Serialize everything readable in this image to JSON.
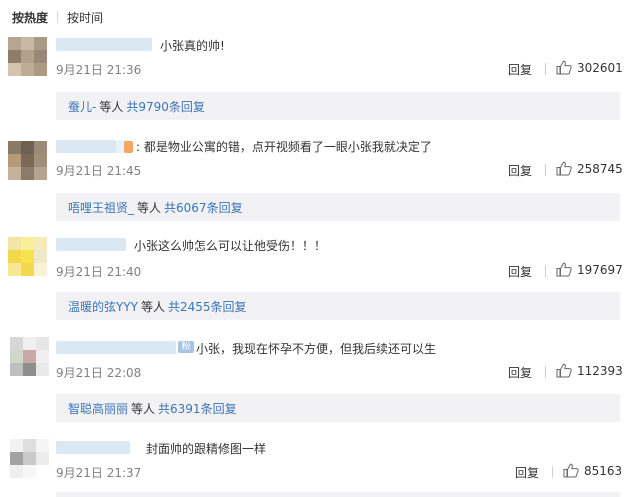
{
  "sort": {
    "hot_label": "按热度",
    "time_label": "按时间"
  },
  "comments": [
    {
      "text": "小张真的帅!",
      "time": "9月21日 21:36",
      "reply_label": "回复",
      "likes": "302601",
      "sub": {
        "name": "蚕儿-",
        "mid": "等人",
        "link": "共9790条回复"
      }
    },
    {
      "text": ": 都是物业公寓的错，点开视频看了一眼小张我就决定了",
      "time": "9月21日 21:45",
      "reply_label": "回复",
      "likes": "258745",
      "sub": {
        "name": "唔哩王祖贤_",
        "mid": "等人",
        "link": "共6067条回复"
      }
    },
    {
      "text": "小张这么帅怎么可以让他受伤！！！",
      "time": "9月21日 21:40",
      "reply_label": "回复",
      "likes": "197697",
      "sub": {
        "name": "温暖的弦YYY",
        "mid": "等人",
        "link": "共2455条回复"
      }
    },
    {
      "text": "小张，我现在怀孕不方便，但我后续还可以生",
      "badge": "粉",
      "time": "9月21日 22:08",
      "reply_label": "回复",
      "likes": "112393",
      "sub": {
        "name": "智聪高丽丽",
        "mid": "等人",
        "link": "共6391条回复"
      }
    },
    {
      "text": "封面帅的跟精修图一样",
      "time": "9月21日 21:37",
      "reply_label": "回复",
      "likes": "85163"
    }
  ],
  "colors": {
    "link": "#3a74b8",
    "sub_bg": "#f2f2f5",
    "time": "#808080",
    "text": "#333333"
  }
}
